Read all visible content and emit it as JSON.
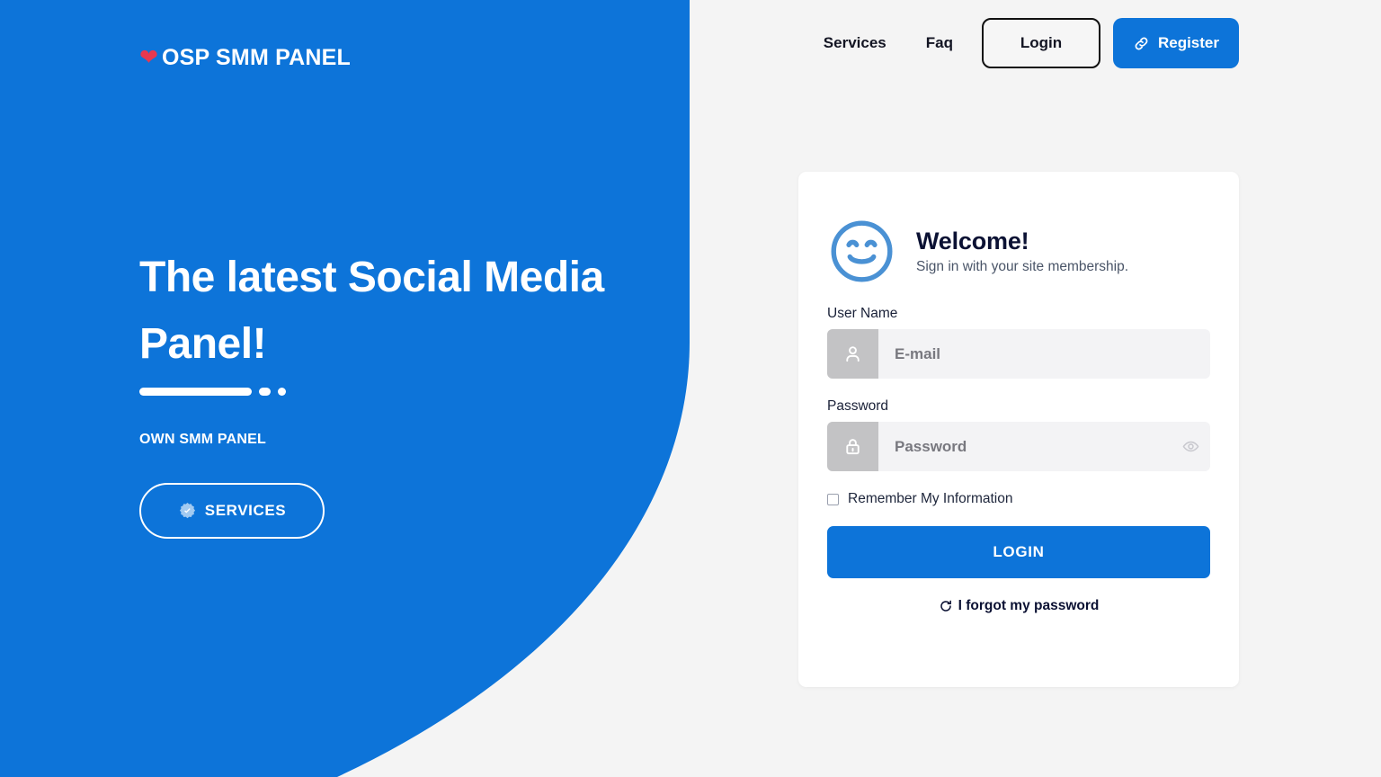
{
  "brand": {
    "icon": "heart-icon",
    "text": "OSP SMM PANEL"
  },
  "nav": {
    "links": [
      {
        "label": "Services",
        "name": "nav-link-services"
      },
      {
        "label": "Faq",
        "name": "nav-link-faq"
      }
    ],
    "login_label": "Login",
    "register_label": "Register",
    "register_icon": "link-chain-icon"
  },
  "hero": {
    "title": "The latest Social Media Panel!",
    "subtitle": "OWN SMM PANEL",
    "cta_label": "SERVICES",
    "cta_icon": "verified-badge-icon"
  },
  "login_card": {
    "welcome_icon": "smiley-face-icon",
    "welcome_title": "Welcome!",
    "welcome_subtitle": "Sign in with your site membership.",
    "username": {
      "label": "User Name",
      "placeholder": "E-mail",
      "value": "",
      "icon": "user-icon"
    },
    "password": {
      "label": "Password",
      "placeholder": "Password",
      "value": "",
      "icon": "lock-icon",
      "toggle_icon": "eye-icon"
    },
    "remember_label": "Remember My Information",
    "remember_checked": false,
    "submit_label": "LOGIN",
    "forgot_label": "I forgot my password",
    "forgot_icon": "refresh-icon"
  },
  "colors": {
    "brand_blue": "#0d74d9",
    "page_background": "#f4f4f4",
    "card_background": "#ffffff",
    "input_background": "#f3f3f5",
    "input_icon_box": "#c3c3c5",
    "heart_red": "#e8384f",
    "heading_dark": "#0b1133"
  }
}
